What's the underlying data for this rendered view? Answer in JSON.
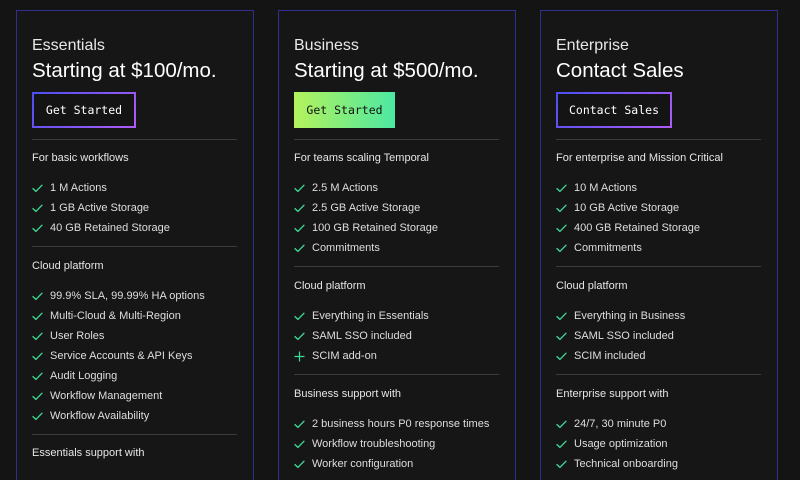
{
  "colors": {
    "check": "#3ddc97",
    "plus": "#3ddc97",
    "card_border": "#2f2f8e"
  },
  "cards": [
    {
      "name": "Essentials",
      "price": "Starting at $100/mo.",
      "button": "Get Started",
      "sections": [
        {
          "title": "For basic workflows",
          "items": [
            {
              "icon": "check-icon",
              "text": "1 M Actions"
            },
            {
              "icon": "check-icon",
              "text": "1 GB Active Storage"
            },
            {
              "icon": "check-icon",
              "text": "40 GB Retained Storage"
            }
          ]
        },
        {
          "title": "Cloud platform",
          "items": [
            {
              "icon": "check-icon",
              "text": "99.9% SLA, 99.99% HA options"
            },
            {
              "icon": "check-icon",
              "text": "Multi-Cloud & Multi-Region"
            },
            {
              "icon": "check-icon",
              "text": "User Roles"
            },
            {
              "icon": "check-icon",
              "text": "Service Accounts & API Keys"
            },
            {
              "icon": "check-icon",
              "text": "Audit Logging"
            },
            {
              "icon": "check-icon",
              "text": "Workflow Management"
            },
            {
              "icon": "check-icon",
              "text": "Workflow Availability"
            }
          ]
        },
        {
          "title": "Essentials support with",
          "items": []
        }
      ]
    },
    {
      "name": "Business",
      "price": "Starting at $500/mo.",
      "button": "Get Started",
      "sections": [
        {
          "title": "For teams scaling Temporal",
          "items": [
            {
              "icon": "check-icon",
              "text": "2.5 M Actions"
            },
            {
              "icon": "check-icon",
              "text": "2.5 GB Active Storage"
            },
            {
              "icon": "check-icon",
              "text": "100 GB Retained Storage"
            },
            {
              "icon": "check-icon",
              "text": "Commitments"
            }
          ]
        },
        {
          "title": "Cloud platform",
          "items": [
            {
              "icon": "check-icon",
              "text": "Everything in Essentials"
            },
            {
              "icon": "check-icon",
              "text": "SAML SSO included"
            },
            {
              "icon": "plus-icon",
              "text": "SCIM add-on"
            }
          ]
        },
        {
          "title": "Business support with",
          "items": [
            {
              "icon": "check-icon",
              "text": "2 business hours P0 response times"
            },
            {
              "icon": "check-icon",
              "text": "Workflow troubleshooting"
            },
            {
              "icon": "check-icon",
              "text": "Worker configuration"
            }
          ]
        }
      ]
    },
    {
      "name": "Enterprise",
      "price": "Contact Sales",
      "button": "Contact Sales",
      "sections": [
        {
          "title": "For enterprise and Mission Critical",
          "items": [
            {
              "icon": "check-icon",
              "text": "10 M Actions"
            },
            {
              "icon": "check-icon",
              "text": "10 GB Active Storage"
            },
            {
              "icon": "check-icon",
              "text": "400 GB Retained Storage"
            },
            {
              "icon": "check-icon",
              "text": "Commitments"
            }
          ]
        },
        {
          "title": "Cloud platform",
          "items": [
            {
              "icon": "check-icon",
              "text": "Everything in Business"
            },
            {
              "icon": "check-icon",
              "text": "SAML SSO included"
            },
            {
              "icon": "check-icon",
              "text": "SCIM included"
            }
          ]
        },
        {
          "title": "Enterprise support with",
          "items": [
            {
              "icon": "check-icon",
              "text": "24/7, 30 minute P0"
            },
            {
              "icon": "check-icon",
              "text": "Usage optimization"
            },
            {
              "icon": "check-icon",
              "text": "Technical onboarding"
            }
          ]
        }
      ]
    }
  ]
}
